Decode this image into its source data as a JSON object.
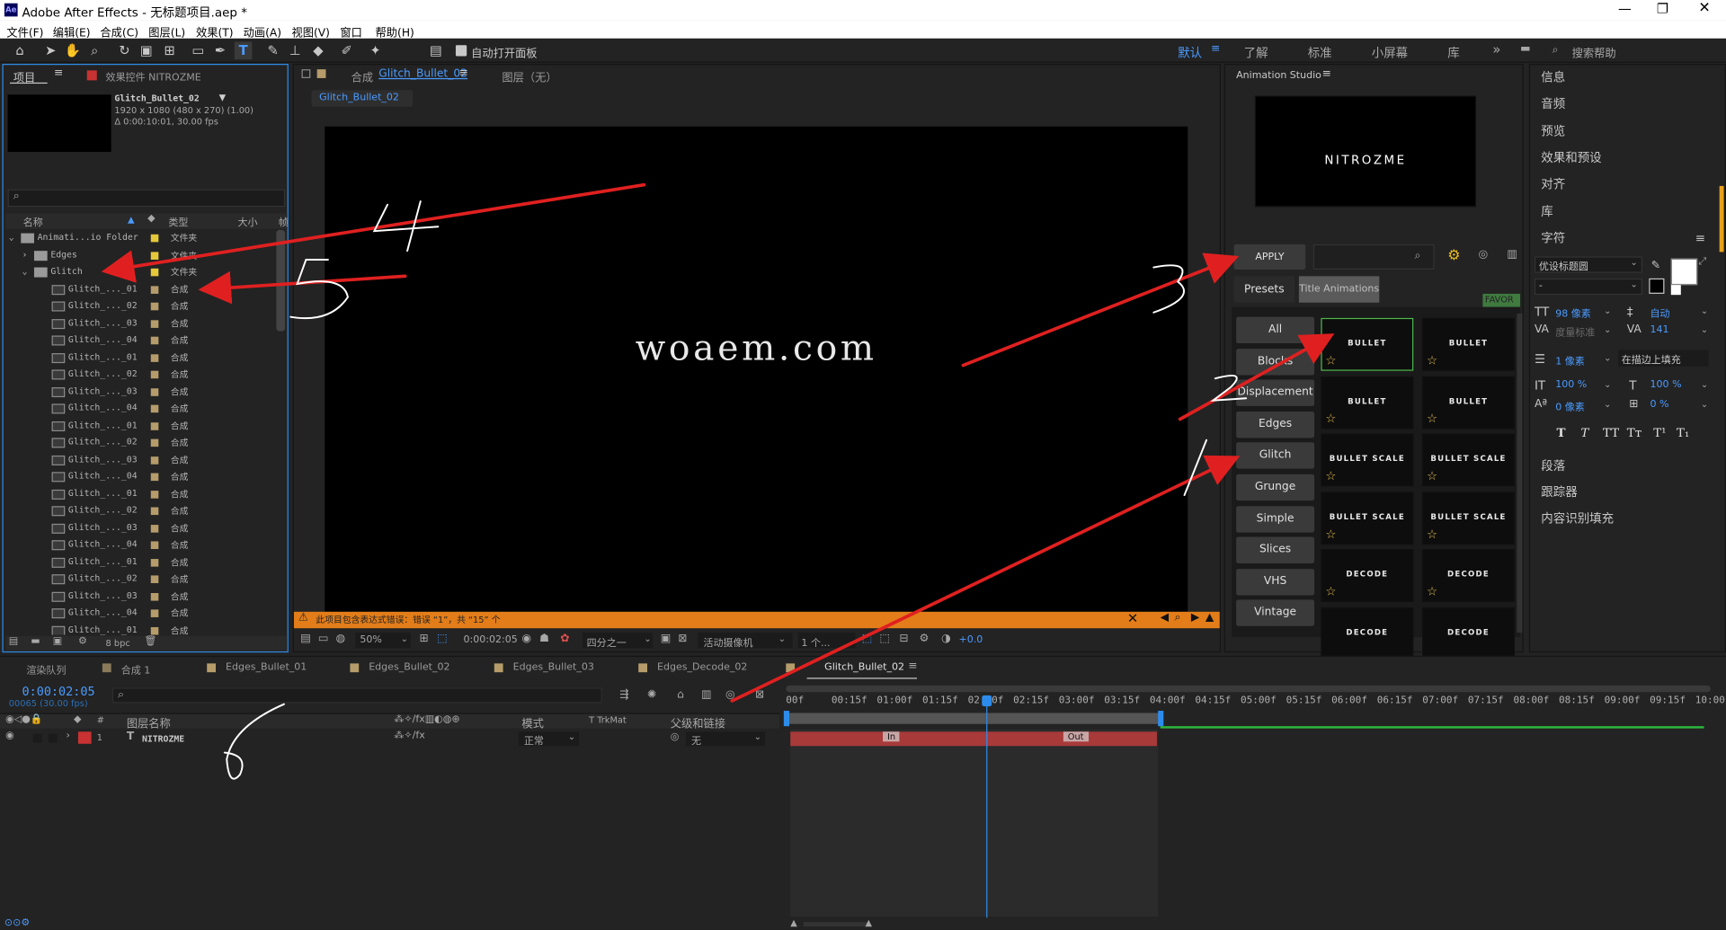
{
  "window_title": "Adobe After Effects - 无标题项目.aep *",
  "app_icon": "Ae",
  "menu": [
    "文件(F)",
    "编辑(E)",
    "合成(C)",
    "图层(L)",
    "效果(T)",
    "动画(A)",
    "视图(V)",
    "窗口",
    "帮助(H)"
  ],
  "toolbar": {
    "auto_open_label": "自动打开面板"
  },
  "workspaces": [
    "默认",
    "了解",
    "标准",
    "小屏幕",
    "库"
  ],
  "search_help": "搜索帮助",
  "project": {
    "tab_label": "项目",
    "effects_tab": "效果控件 NITROZME",
    "comp_name": "Glitch_Bullet_02",
    "comp_info": "1920 x 1080  (480 x 270) (1.00)",
    "comp_duration": "Δ 0:00:10:01, 30.00 fps",
    "col_name": "名称",
    "col_type": "类型",
    "col_size": "大小",
    "col_frame": "帧",
    "bpc": "8 bpc",
    "rows": [
      {
        "name": "Animati...io Folder",
        "type": "文件夹",
        "kind": "folder",
        "color": "#e5c73a"
      },
      {
        "name": "Edges",
        "type": "文件夹",
        "kind": "folder",
        "color": "#e5c73a"
      },
      {
        "name": "Glitch",
        "type": "文件夹",
        "kind": "folder",
        "color": "#e5c73a"
      },
      {
        "name": "Glitch_..._01",
        "type": "合成",
        "kind": "comp",
        "color": "#b59c6a"
      },
      {
        "name": "Glitch_..._02",
        "type": "合成",
        "kind": "comp",
        "color": "#b59c6a"
      },
      {
        "name": "Glitch_..._03",
        "type": "合成",
        "kind": "comp",
        "color": "#b59c6a"
      },
      {
        "name": "Glitch_..._04",
        "type": "合成",
        "kind": "comp",
        "color": "#b59c6a"
      },
      {
        "name": "Glitch_..._01",
        "type": "合成",
        "kind": "comp",
        "color": "#b59c6a"
      },
      {
        "name": "Glitch_..._02",
        "type": "合成",
        "kind": "comp",
        "color": "#b59c6a"
      },
      {
        "name": "Glitch_..._03",
        "type": "合成",
        "kind": "comp",
        "color": "#b59c6a"
      },
      {
        "name": "Glitch_..._04",
        "type": "合成",
        "kind": "comp",
        "color": "#b59c6a"
      },
      {
        "name": "Glitch_..._01",
        "type": "合成",
        "kind": "comp",
        "color": "#b59c6a"
      },
      {
        "name": "Glitch_..._02",
        "type": "合成",
        "kind": "comp",
        "color": "#b59c6a"
      },
      {
        "name": "Glitch_..._03",
        "type": "合成",
        "kind": "comp",
        "color": "#b59c6a"
      },
      {
        "name": "Glitch_..._04",
        "type": "合成",
        "kind": "comp",
        "color": "#b59c6a"
      },
      {
        "name": "Glitch_..._01",
        "type": "合成",
        "kind": "comp",
        "color": "#b59c6a"
      },
      {
        "name": "Glitch_..._02",
        "type": "合成",
        "kind": "comp",
        "color": "#b59c6a"
      },
      {
        "name": "Glitch_..._03",
        "type": "合成",
        "kind": "comp",
        "color": "#b59c6a"
      },
      {
        "name": "Glitch_..._04",
        "type": "合成",
        "kind": "comp",
        "color": "#b59c6a"
      },
      {
        "name": "Glitch_..._01",
        "type": "合成",
        "kind": "comp",
        "color": "#b59c6a"
      },
      {
        "name": "Glitch_..._02",
        "type": "合成",
        "kind": "comp",
        "color": "#b59c6a"
      },
      {
        "name": "Glitch_..._03",
        "type": "合成",
        "kind": "comp",
        "color": "#b59c6a"
      },
      {
        "name": "Glitch_..._04",
        "type": "合成",
        "kind": "comp",
        "color": "#b59c6a"
      },
      {
        "name": "Glitch_..._01",
        "type": "合成",
        "kind": "comp",
        "color": "#b59c6a"
      }
    ]
  },
  "composition": {
    "tab_label": "合成",
    "tab_comp": "Glitch_Bullet_02",
    "layer_tab": "图层（无）",
    "subtab": "Glitch_Bullet_02",
    "viewer_text": "woaem.com",
    "warning": "此项目包含表达式错误：错误 “1”，共 “15” 个",
    "zoom": "50%",
    "timecode": "0:00:02:05",
    "quality": "四分之一",
    "camera": "活动摄像机",
    "views": "1 个...",
    "exposure": "+0.0"
  },
  "animation_studio": {
    "title": "Animation Studio",
    "logo": "NITROZME",
    "apply": "APPLY",
    "tab_presets": "Presets",
    "tab_title_anim": "Title Animations",
    "favor": "FAVOR",
    "categories": [
      "All",
      "Blocks",
      "Displacement",
      "Edges",
      "Glitch",
      "Grunge",
      "Simple",
      "Slices",
      "VHS",
      "Vintage"
    ],
    "thumbs": [
      "BULLET",
      "BULLET",
      "BULLET",
      "BULLET",
      "BULLET SCALE",
      "BULLET SCALE",
      "BULLET SCALE",
      "BULLET SCALE",
      "DECODE",
      "DECODE",
      "DECODE",
      "DECODE"
    ]
  },
  "right_panels": [
    "信息",
    "音频",
    "预览",
    "效果和预设",
    "对齐",
    "库",
    "字符",
    "段落",
    "跟踪器",
    "内容识别填充"
  ],
  "character": {
    "font": "优设标题圆",
    "style": "-",
    "size": "98 像素",
    "leading": "自动",
    "kerning": "度量标准",
    "tracking": "141",
    "stroke": "1 像素",
    "stroke_mode": "在描边上填充",
    "vscale": "100 %",
    "hscale": "100 %",
    "baseline": "0 像素",
    "tsume": "0 %"
  },
  "timeline": {
    "tabs": [
      "渲染队列",
      "合成 1",
      "Edges_Bullet_01",
      "Edges_Bullet_02",
      "Edges_Bullet_03",
      "Edges_Decode_02",
      "Glitch_Bullet_02"
    ],
    "timecode": "0:00:02:05",
    "frames": "00065 (30.00 fps)",
    "col_layer": "图层名称",
    "col_mode": "模式",
    "col_trkmat": "T   TrkMat",
    "col_parent": "父级和链接",
    "layer_index": "1",
    "layer_name": "NITROZME",
    "layer_mode": "正常",
    "layer_parent": "无",
    "ruler": [
      "00f",
      "00:15f",
      "01:00f",
      "01:15f",
      "02:00f",
      "02:15f",
      "03:00f",
      "03:15f",
      "04:00f",
      "04:15f",
      "05:00f",
      "05:15f",
      "06:00f",
      "06:15f",
      "07:00f",
      "07:15f",
      "08:00f",
      "08:15f",
      "09:00f",
      "09:15f",
      "10:00"
    ],
    "marker_in": "In",
    "marker_out": "Out"
  },
  "annotations": [
    "1",
    "2",
    "3",
    "4",
    "5",
    "6"
  ]
}
